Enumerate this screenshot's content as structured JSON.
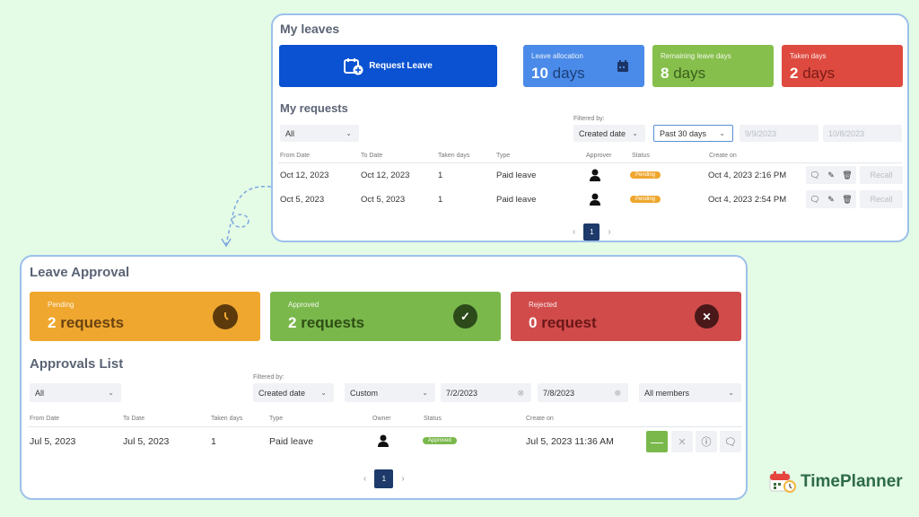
{
  "colors": {
    "background": "#e4fbe6",
    "panel_border": "#9cc0ea",
    "request_btn": "#0a52d1",
    "allocation": "#4a8ae8",
    "remaining": "#86bf4c",
    "taken": "#de4a3f",
    "pending": "#efa72f",
    "approved": "#7ab84c",
    "rejected": "#d14b4b",
    "pager_active": "#1d3a6a",
    "logo_text": "#2d6b46"
  },
  "my_leaves": {
    "title": "My leaves",
    "request_button": {
      "label": "Request Leave",
      "icon": "calendar-plus-icon"
    },
    "cards": [
      {
        "label": "Leave allocation",
        "value": "10",
        "unit": "days",
        "icon": "calendar-icon"
      },
      {
        "label": "Remaining leave days",
        "value": "8",
        "unit": "days"
      },
      {
        "label": "Taken days",
        "value": "2",
        "unit": "days"
      }
    ]
  },
  "my_requests": {
    "title": "My requests",
    "type_filter": "All",
    "filtered_by_label": "Filtered by:",
    "filter_field": "Created date",
    "range": "Past 30 days",
    "from": "9/9/2023",
    "to": "10/8/2023",
    "columns": [
      "From Date",
      "To Date",
      "Taken days",
      "Type",
      "Approver",
      "Status",
      "Create on"
    ],
    "rows": [
      {
        "from": "Oct 12, 2023",
        "to": "Oct 12, 2023",
        "days": "1",
        "type": "Paid leave",
        "status": "Pending",
        "created": "Oct 4, 2023 2:16 PM",
        "recall": "Recall"
      },
      {
        "from": "Oct 5, 2023",
        "to": "Oct 5, 2023",
        "days": "1",
        "type": "Paid leave",
        "status": "Pending",
        "created": "Oct 4, 2023 2:54 PM",
        "recall": "Recall"
      }
    ],
    "pagination": {
      "prev": "‹",
      "page": "1",
      "next": "›"
    }
  },
  "leave_approval": {
    "title": "Leave Approval",
    "cards": [
      {
        "label": "Pending",
        "value": "2",
        "unit": "requests",
        "icon": "clock-icon"
      },
      {
        "label": "Approved",
        "value": "2",
        "unit": "requests",
        "icon": "check-icon"
      },
      {
        "label": "Rejected",
        "value": "0",
        "unit": "request",
        "icon": "x-icon"
      }
    ]
  },
  "approvals_list": {
    "title": "Approvals List",
    "type_filter": "All",
    "filtered_by_label": "Filtered by:",
    "filter_field": "Created date",
    "range": "Custom",
    "from": "7/2/2023",
    "to": "7/8/2023",
    "members": "All members",
    "columns": [
      "From Date",
      "To Date",
      "Taken days",
      "Type",
      "Owner",
      "Status",
      "Create on"
    ],
    "rows": [
      {
        "from": "Jul 5, 2023",
        "to": "Jul 5, 2023",
        "days": "1",
        "type": "Paid leave",
        "status": "Approved",
        "created": "Jul 5, 2023 11:36 AM"
      }
    ],
    "pagination": {
      "prev": "‹",
      "page": "1",
      "next": "›"
    }
  },
  "brand": {
    "name": "TimePlanner"
  }
}
